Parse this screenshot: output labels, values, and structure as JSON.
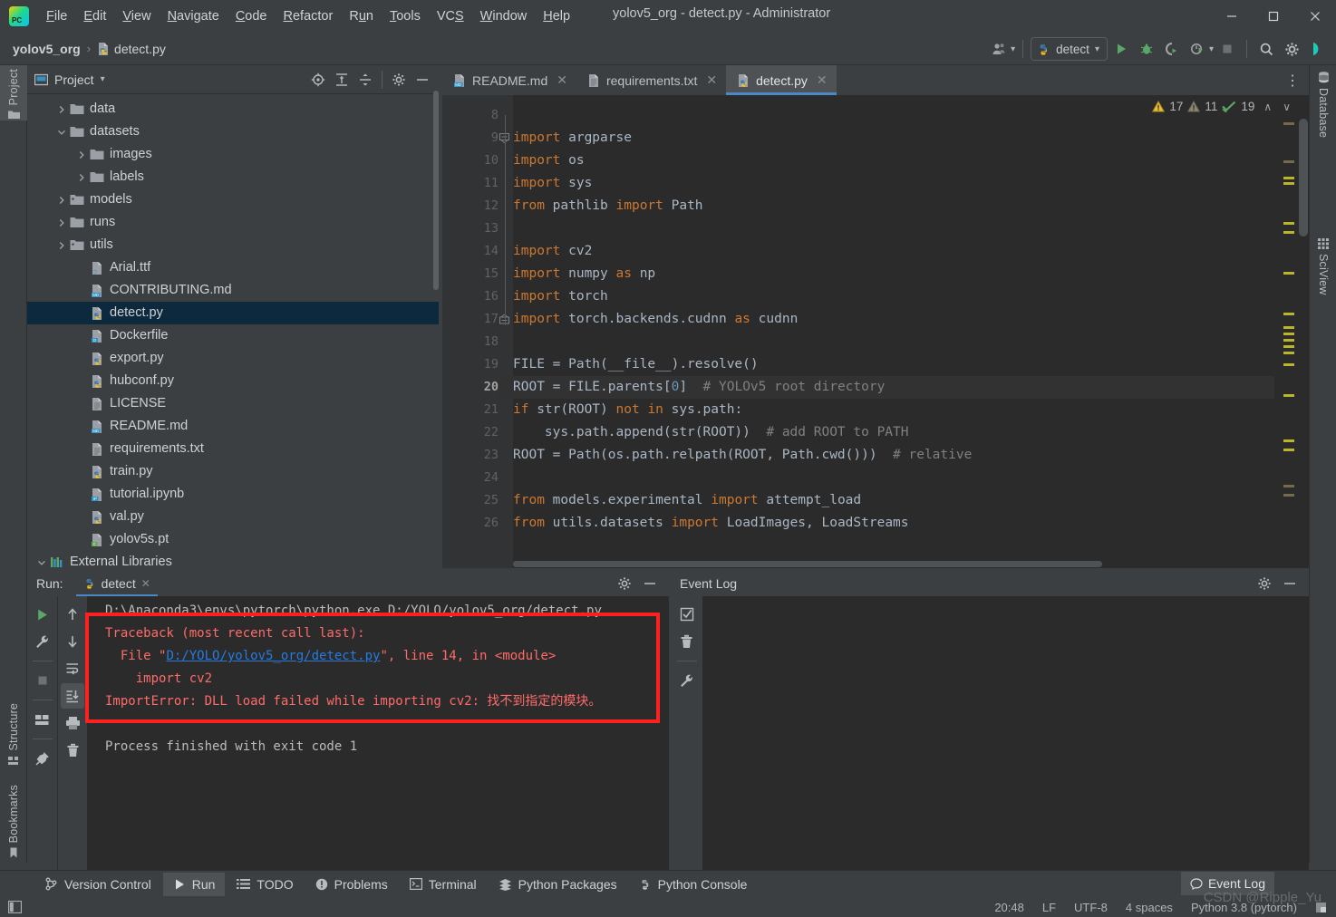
{
  "window": {
    "title": "yolov5_org - detect.py - Administrator",
    "minimize": "–",
    "maximize": "☐",
    "close": "✕"
  },
  "menubar": {
    "items": [
      {
        "pre": "",
        "mn": "F",
        "post": "ile"
      },
      {
        "pre": "",
        "mn": "E",
        "post": "dit"
      },
      {
        "pre": "",
        "mn": "V",
        "post": "iew"
      },
      {
        "pre": "",
        "mn": "N",
        "post": "avigate"
      },
      {
        "pre": "",
        "mn": "C",
        "post": "ode"
      },
      {
        "pre": "",
        "mn": "R",
        "post": "efactor"
      },
      {
        "pre": "R",
        "mn": "u",
        "post": "n"
      },
      {
        "pre": "",
        "mn": "T",
        "post": "ools"
      },
      {
        "pre": "VC",
        "mn": "S",
        "post": ""
      },
      {
        "pre": "",
        "mn": "W",
        "post": "indow"
      },
      {
        "pre": "",
        "mn": "H",
        "post": "elp"
      }
    ]
  },
  "breadcrumb": {
    "project": "yolov5_org",
    "separator": "›",
    "file": "detect.py"
  },
  "toolbar": {
    "run_config": "detect",
    "run_config_caret": "▾",
    "accounts_caret": "▾",
    "more_caret": "▾"
  },
  "rails": {
    "left": [
      {
        "label": "Project",
        "active": true
      },
      {
        "label": "Structure",
        "active": false
      },
      {
        "label": "Bookmarks",
        "active": false
      }
    ],
    "right": [
      {
        "label": "Database"
      },
      {
        "label": "SciView"
      }
    ]
  },
  "project_panel": {
    "title": "Project",
    "title_caret": "▾",
    "tree": [
      {
        "label": "data",
        "indent": 1,
        "arrow": "›",
        "icon": "folder",
        "selected": false
      },
      {
        "label": "datasets",
        "indent": 1,
        "arrow": "∨",
        "icon": "folder",
        "selected": false
      },
      {
        "label": "images",
        "indent": 2,
        "arrow": "›",
        "icon": "folder",
        "selected": false
      },
      {
        "label": "labels",
        "indent": 2,
        "arrow": "›",
        "icon": "folder",
        "selected": false
      },
      {
        "label": "models",
        "indent": 1,
        "arrow": "›",
        "icon": "folder-pkg",
        "selected": false
      },
      {
        "label": "runs",
        "indent": 1,
        "arrow": "›",
        "icon": "folder",
        "selected": false
      },
      {
        "label": "utils",
        "indent": 1,
        "arrow": "›",
        "icon": "folder-pkg",
        "selected": false
      },
      {
        "label": "Arial.ttf",
        "indent": 2,
        "arrow": "",
        "icon": "file-unknown",
        "selected": false
      },
      {
        "label": "CONTRIBUTING.md",
        "indent": 2,
        "arrow": "",
        "icon": "file-md",
        "selected": false
      },
      {
        "label": "detect.py",
        "indent": 2,
        "arrow": "",
        "icon": "file-py",
        "selected": true
      },
      {
        "label": "Dockerfile",
        "indent": 2,
        "arrow": "",
        "icon": "file-docker",
        "selected": false
      },
      {
        "label": "export.py",
        "indent": 2,
        "arrow": "",
        "icon": "file-py",
        "selected": false
      },
      {
        "label": "hubconf.py",
        "indent": 2,
        "arrow": "",
        "icon": "file-py",
        "selected": false
      },
      {
        "label": "LICENSE",
        "indent": 2,
        "arrow": "",
        "icon": "file-txt",
        "selected": false
      },
      {
        "label": "README.md",
        "indent": 2,
        "arrow": "",
        "icon": "file-md",
        "selected": false
      },
      {
        "label": "requirements.txt",
        "indent": 2,
        "arrow": "",
        "icon": "file-txt",
        "selected": false
      },
      {
        "label": "train.py",
        "indent": 2,
        "arrow": "",
        "icon": "file-py",
        "selected": false
      },
      {
        "label": "tutorial.ipynb",
        "indent": 2,
        "arrow": "",
        "icon": "file-ipynb",
        "selected": false
      },
      {
        "label": "val.py",
        "indent": 2,
        "arrow": "",
        "icon": "file-py",
        "selected": false
      },
      {
        "label": "yolov5s.pt",
        "indent": 2,
        "arrow": "",
        "icon": "file-pt",
        "selected": false
      },
      {
        "label": "External Libraries",
        "indent": 0,
        "arrow": "∨",
        "icon": "libs",
        "selected": false
      }
    ]
  },
  "editor": {
    "tabs": [
      {
        "label": "README.md",
        "icon": "file-md",
        "active": false
      },
      {
        "label": "requirements.txt",
        "icon": "file-txt",
        "active": false
      },
      {
        "label": "detect.py",
        "icon": "file-py",
        "active": true
      }
    ],
    "tab_close": "✕",
    "more_tabs": "⋮",
    "inspection": {
      "warnings": "17",
      "weak_warnings": "11",
      "checks": "19",
      "prev": "∧",
      "next": "∨"
    },
    "current_line": 20,
    "lines": [
      {
        "n": 8,
        "text": ""
      },
      {
        "n": 9,
        "text": "import argparse"
      },
      {
        "n": 10,
        "text": "import os"
      },
      {
        "n": 11,
        "text": "import sys"
      },
      {
        "n": 12,
        "text": "from pathlib import Path"
      },
      {
        "n": 13,
        "text": ""
      },
      {
        "n": 14,
        "text": "import cv2"
      },
      {
        "n": 15,
        "text": "import numpy as np"
      },
      {
        "n": 16,
        "text": "import torch"
      },
      {
        "n": 17,
        "text": "import torch.backends.cudnn as cudnn"
      },
      {
        "n": 18,
        "text": ""
      },
      {
        "n": 19,
        "text": "FILE = Path(__file__).resolve()"
      },
      {
        "n": 20,
        "text": "ROOT = FILE.parents[0]  # YOLOv5 root directory"
      },
      {
        "n": 21,
        "text": "if str(ROOT) not in sys.path:"
      },
      {
        "n": 22,
        "text": "    sys.path.append(str(ROOT))  # add ROOT to PATH"
      },
      {
        "n": 23,
        "text": "ROOT = Path(os.path.relpath(ROOT, Path.cwd()))  # relative"
      },
      {
        "n": 24,
        "text": ""
      },
      {
        "n": 25,
        "text": "from models.experimental import attempt_load"
      },
      {
        "n": 26,
        "text": "from utils.datasets import LoadImages, LoadStreams"
      }
    ]
  },
  "run_panel": {
    "label": "Run:",
    "tab": "detect",
    "tab_close": "✕",
    "console": {
      "command": "D:\\Anaconda3\\envs\\pytorch\\python.exe D:/YOLO/yolov5_org/detect.py",
      "traceback_header": "Traceback (most recent call last):",
      "file_prefix": "  File \"",
      "file_link": "D:/YOLO/yolov5_org/detect.py",
      "file_suffix": "\", line 14, in <module>",
      "import_line": "    import cv2",
      "error_line": "ImportError: DLL load failed while importing cv2: 找不到指定的模块。",
      "exit_line": "Process finished with exit code 1"
    }
  },
  "event_log": {
    "title": "Event Log"
  },
  "tool_window_bar": {
    "items": [
      {
        "label": "Version Control",
        "icon": "branch-icon",
        "active": false
      },
      {
        "label": "Run",
        "icon": "play-icon",
        "active": true
      },
      {
        "label": "TODO",
        "icon": "list-icon",
        "active": false
      },
      {
        "label": "Problems",
        "icon": "warning-icon",
        "active": false
      },
      {
        "label": "Terminal",
        "icon": "terminal-icon",
        "active": false
      },
      {
        "label": "Python Packages",
        "icon": "packages-icon",
        "active": false
      },
      {
        "label": "Python Console",
        "icon": "python-icon",
        "active": false
      }
    ],
    "event_log_button": "Event Log"
  },
  "statusbar": {
    "position": "20:48",
    "line_separator": "LF",
    "encoding": "UTF-8",
    "indent": "4 spaces",
    "interpreter": "Python 3.8 (pytorch)"
  },
  "watermark": "CSDN @Ripple_Yu",
  "colors": {
    "accent": "#4a88c7",
    "selection": "#0d293e",
    "error": "#ff6b68",
    "red_box": "#ff2020",
    "keyword": "#cc7832",
    "comment": "#808080",
    "link": "#287bde",
    "warning": "#bbb529"
  }
}
